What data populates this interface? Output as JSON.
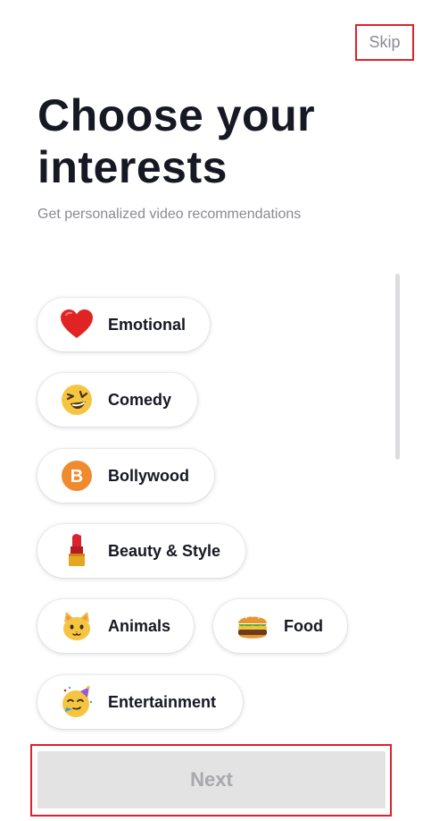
{
  "header": {
    "skip_label": "Skip",
    "title_line1": "Choose your",
    "title_line2": "interests",
    "subtitle": "Get personalized video recommendations"
  },
  "interests": [
    {
      "label": "Emotional",
      "icon": "red-heart-icon"
    },
    {
      "label": "Comedy",
      "icon": "laughing-face-icon"
    },
    {
      "label": "Bollywood",
      "icon": "b-badge-icon"
    },
    {
      "label": "Beauty & Style",
      "icon": "lipstick-icon"
    },
    {
      "label": "Animals",
      "icon": "cat-face-icon"
    },
    {
      "label": "Food",
      "icon": "hamburger-icon"
    },
    {
      "label": "Entertainment",
      "icon": "partying-face-icon"
    }
  ],
  "footer": {
    "next_label": "Next"
  },
  "colors": {
    "highlight_outline": "#e0202a",
    "next_disabled_bg": "#e3e3e4",
    "next_disabled_text": "#a8a8ad"
  }
}
